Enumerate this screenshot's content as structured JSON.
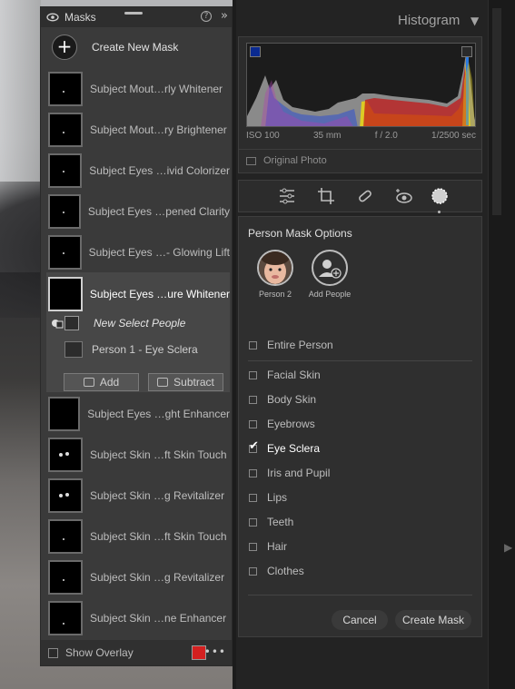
{
  "masks_panel": {
    "title": "Masks",
    "create_new": "Create New Mask",
    "items": [
      {
        "label": "Subject Mout…rly Whitener"
      },
      {
        "label": "Subject Mout…ry Brightener"
      },
      {
        "label": "Subject Eyes …ivid Colorizer"
      },
      {
        "label": "Subject Eyes …pened Clarity"
      },
      {
        "label": "Subject Eyes …- Glowing Lift"
      },
      {
        "label": "Subject Eyes …ure Whitener"
      },
      {
        "label": "Subject Eyes …ght Enhancer"
      },
      {
        "label": "Subject Skin …ft Skin Touch"
      },
      {
        "label": "Subject Skin …g Revitalizer"
      },
      {
        "label": "Subject Skin …ft Skin Touch"
      },
      {
        "label": "Subject Skin …g Revitalizer"
      },
      {
        "label": "Subject Skin …ne Enhancer"
      }
    ],
    "selected": {
      "sub_component": "New Select People",
      "person_component": "Person 1 - Eye Sclera",
      "add_label": "Add",
      "subtract_label": "Subtract"
    },
    "footer": {
      "show_overlay": "Show Overlay",
      "overlay_color": "#d42020"
    }
  },
  "histogram": {
    "title": "Histogram",
    "iso": "ISO 100",
    "focal": "35 mm",
    "aperture": "f / 2.0",
    "shutter": "1/2500 sec",
    "original_photo": "Original Photo"
  },
  "toolbar": {
    "tools": [
      "edit-sliders-icon",
      "crop-icon",
      "healing-icon",
      "red-eye-icon",
      "masking-icon"
    ]
  },
  "options": {
    "title": "Person Mask Options",
    "people": [
      {
        "label": "Person 2"
      },
      {
        "label": "Add People"
      }
    ],
    "entire_person": "Entire Person",
    "parts": [
      {
        "label": "Facial Skin",
        "checked": false
      },
      {
        "label": "Body Skin",
        "checked": false
      },
      {
        "label": "Eyebrows",
        "checked": false
      },
      {
        "label": "Eye Sclera",
        "checked": true
      },
      {
        "label": "Iris and Pupil",
        "checked": false
      },
      {
        "label": "Lips",
        "checked": false
      },
      {
        "label": "Teeth",
        "checked": false
      },
      {
        "label": "Hair",
        "checked": false
      },
      {
        "label": "Clothes",
        "checked": false
      }
    ],
    "cancel_label": "Cancel",
    "create_label": "Create Mask"
  }
}
